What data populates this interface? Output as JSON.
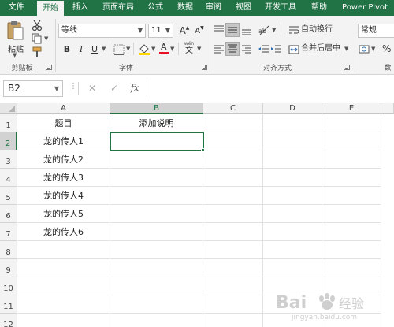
{
  "tabs": {
    "file": "文件",
    "items": [
      {
        "label": "开始"
      },
      {
        "label": "插入"
      },
      {
        "label": "页面布局"
      },
      {
        "label": "公式"
      },
      {
        "label": "数据"
      },
      {
        "label": "审阅"
      },
      {
        "label": "视图"
      },
      {
        "label": "开发工具"
      },
      {
        "label": "帮助"
      },
      {
        "label": "Power Pivot"
      }
    ],
    "active": "开始"
  },
  "ribbon": {
    "clipboard": {
      "paste_label": "粘贴",
      "group_label": "剪贴板"
    },
    "font": {
      "font_name": "等线",
      "font_size": "11",
      "bold": "B",
      "italic": "I",
      "underline": "U",
      "grow": "A",
      "shrink": "A",
      "phonetic_top": "wén",
      "phonetic_char": "文",
      "font_color_letter": "A",
      "group_label": "字体",
      "highlight_color": "#ffd700",
      "font_color": "#e81123"
    },
    "alignment": {
      "wrap_text": "自动换行",
      "merge_center": "合并后居中",
      "group_label": "对齐方式"
    },
    "number": {
      "format": "常规",
      "percent": "%",
      "group_label": "数"
    }
  },
  "formula_bar": {
    "name_box": "B2",
    "cancel": "✕",
    "enter": "✓",
    "fx": "fx",
    "content": ""
  },
  "sheet": {
    "columns": [
      "A",
      "B",
      "C",
      "D",
      "E"
    ],
    "rows": [
      "1",
      "2",
      "3",
      "4",
      "5",
      "6",
      "7",
      "8",
      "9",
      "10",
      "11",
      "12"
    ],
    "selected_cell": "B2",
    "cells": {
      "A1": "题目",
      "B1": "添加说明",
      "A2": "龙的传人1",
      "A3": "龙的传人2",
      "A4": "龙的传人3",
      "A5": "龙的传人4",
      "A6": "龙的传人5",
      "A7": "龙的传人6"
    }
  },
  "watermark": {
    "text": "Bai",
    "sub": "经验",
    "url": "jingyan.baidu.com"
  },
  "colors": {
    "accent": "#217346",
    "ribbon_bg": "#f3f3f3",
    "header_bg": "#f3f3f3",
    "selected_header_bg": "#d2d2d2"
  }
}
